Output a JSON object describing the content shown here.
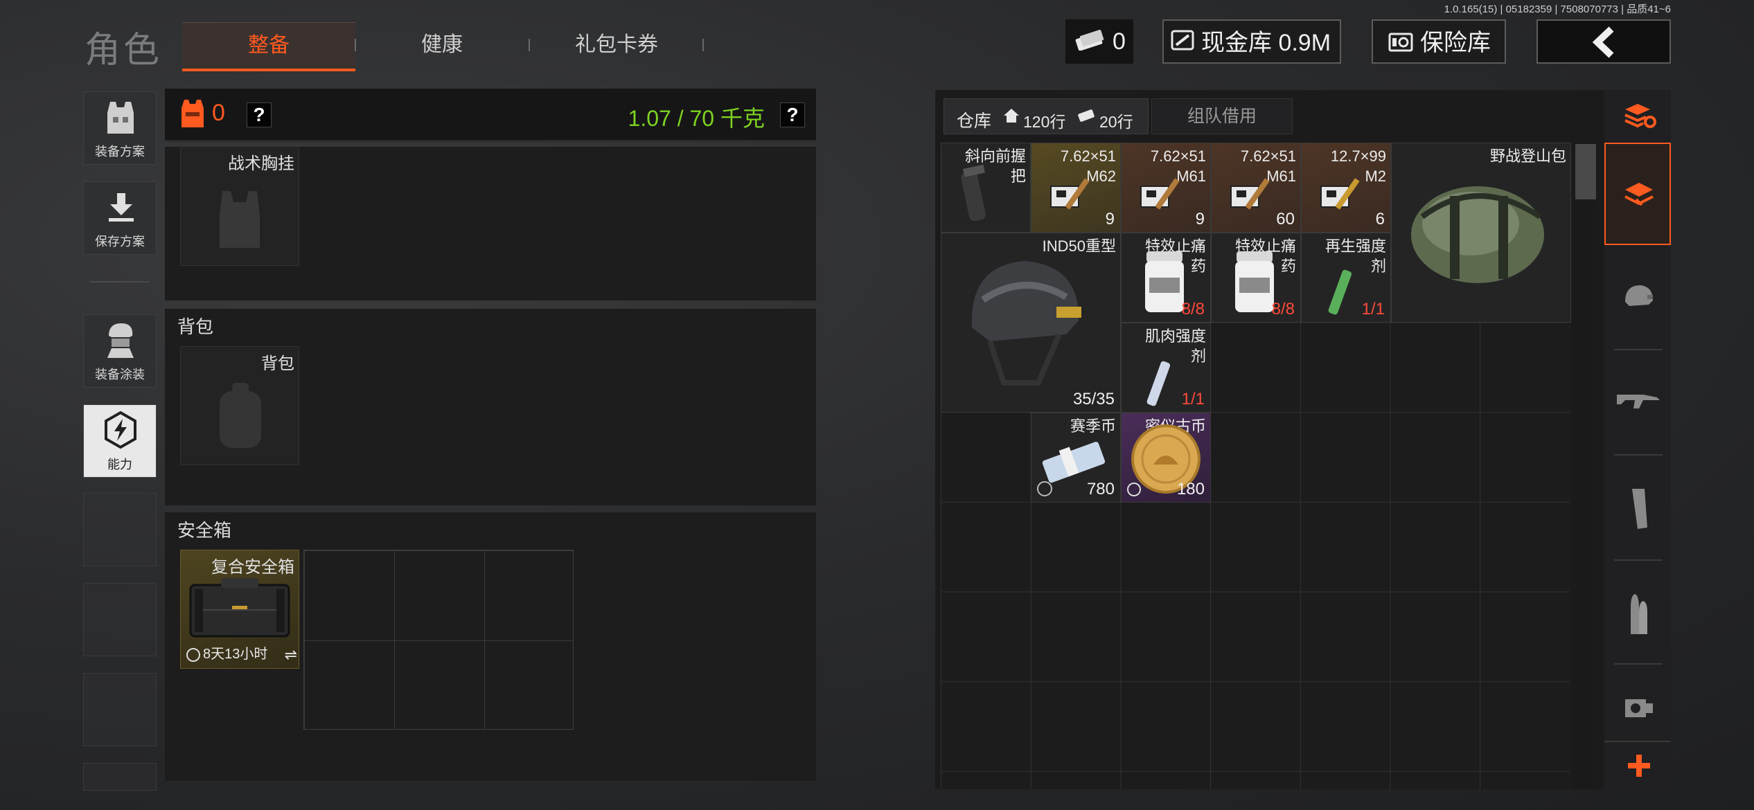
{
  "version": "1.0.165(15) | 05182359 | 7508070773 | 品质41~6",
  "header": {
    "title": "角色",
    "tabs": [
      {
        "label": "整备",
        "active": true
      },
      {
        "label": "健康",
        "active": false
      },
      {
        "label": "礼包卡券",
        "active": false
      }
    ],
    "currency_count": "0",
    "cash_label": "现金库 0.9M",
    "insurance_label": "保险库",
    "back_icon": "chevron-left-icon"
  },
  "left_menu": [
    {
      "label": "装备方案",
      "icon": "vest-icon"
    },
    {
      "label": "保存方案",
      "icon": "download-icon"
    },
    {
      "label": "装备涂装",
      "icon": "soldier-icon"
    },
    {
      "label": "能力",
      "icon": "ability-icon"
    }
  ],
  "loadout": {
    "armor_count": "0",
    "weight": "1.07 / 70 千克",
    "help": "?",
    "chest_rig_label": "战术胸挂",
    "backpack_section": "背包",
    "backpack_label": "背包",
    "safebox_section": "安全箱",
    "safebox_name": "复合安全箱",
    "safebox_timer": "8天13小时"
  },
  "stash": {
    "tab_label": "仓库",
    "rows": "120行",
    "columns": "20行",
    "team_borrow": "组队借用",
    "items": [
      {
        "name": "斜向前握\n把",
        "count": ""
      },
      {
        "name": "7.62×51\nM62",
        "count": "9"
      },
      {
        "name": "7.62×51\nM61",
        "count": "9"
      },
      {
        "name": "7.62×51\nM61",
        "count": "60"
      },
      {
        "name": "12.7×99\nM2",
        "count": "6"
      },
      {
        "name": "野战登山包",
        "count": ""
      },
      {
        "name": "IND50重型",
        "count": "35/35"
      },
      {
        "name": "特效止痛\n药",
        "count": "8/8"
      },
      {
        "name": "特效止痛\n药",
        "count": "8/8"
      },
      {
        "name": "再生强度\n剂",
        "count": "1/1"
      },
      {
        "name": "肌肉强度\n剂",
        "count": "1/1"
      },
      {
        "name": "赛季币",
        "count": "780"
      },
      {
        "name": "密仪古币",
        "count": "180"
      }
    ]
  },
  "accent_color": "#ff5a1f",
  "weight_color": "#7ed321"
}
